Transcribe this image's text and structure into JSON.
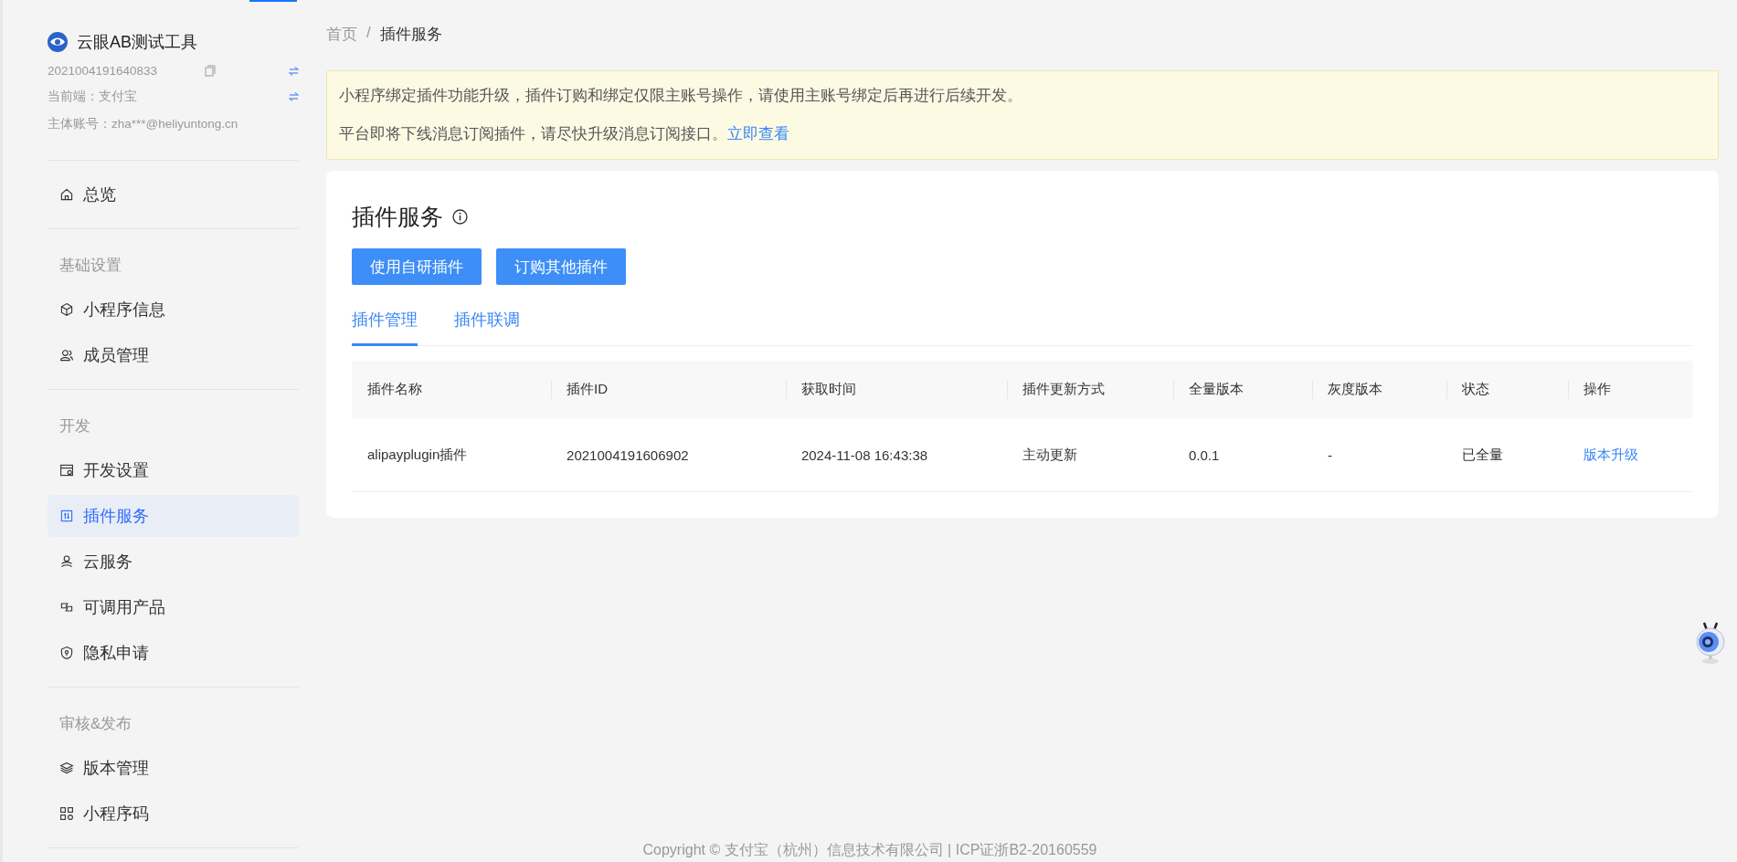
{
  "sidebar": {
    "app": {
      "name": "云眼AB测试工具",
      "id": "2021004191640833",
      "platform": "当前端：支付宝",
      "account": "主体账号：zha***@heliyuntong.cn"
    },
    "sections": [
      {
        "items": [
          {
            "label": "总览",
            "selected": false
          }
        ]
      },
      {
        "title": "基础设置",
        "items": [
          {
            "label": "小程序信息",
            "selected": false
          },
          {
            "label": "成员管理",
            "selected": false
          }
        ]
      },
      {
        "title": "开发",
        "items": [
          {
            "label": "开发设置",
            "selected": false
          },
          {
            "label": "插件服务",
            "selected": true
          },
          {
            "label": "云服务",
            "selected": false
          },
          {
            "label": "可调用产品",
            "selected": false
          },
          {
            "label": "隐私申请",
            "selected": false
          }
        ]
      },
      {
        "title": "审核&发布",
        "items": [
          {
            "label": "版本管理",
            "selected": false
          },
          {
            "label": "小程序码",
            "selected": false
          }
        ]
      }
    ]
  },
  "breadcrumb": [
    "首页",
    "/",
    "插件服务"
  ],
  "notice": {
    "line_1": "小程序绑定插件功能升级，插件订购和绑定仅限主账号操作，请使用主账号绑定后再进行后续开发。",
    "line_2": "平台即将下线消息订阅插件，请尽快升级消息订阅接口。",
    "link": "立即查看"
  },
  "card": {
    "title": "插件服务",
    "buttons": [
      "使用自研插件",
      "订购其他插件"
    ],
    "tabs": [
      {
        "label": "插件管理",
        "selected": true
      },
      {
        "label": "插件联调",
        "selected": false
      }
    ],
    "table": {
      "columns": [
        "插件名称",
        "插件ID",
        "获取时间",
        "插件更新方式",
        "全量版本",
        "灰度版本",
        "状态",
        "操作"
      ],
      "rows": [
        {
          "cells": [
            "alipayplugin插件",
            "2021004191606902",
            "2024-11-08 16:43:38",
            "主动更新",
            "0.0.1",
            "-",
            "已全量"
          ],
          "action": "版本升级"
        }
      ]
    }
  },
  "footer": "Copyright © 支付宝（杭州）信息技术有限公司 | ICP证浙B2-20160559"
}
